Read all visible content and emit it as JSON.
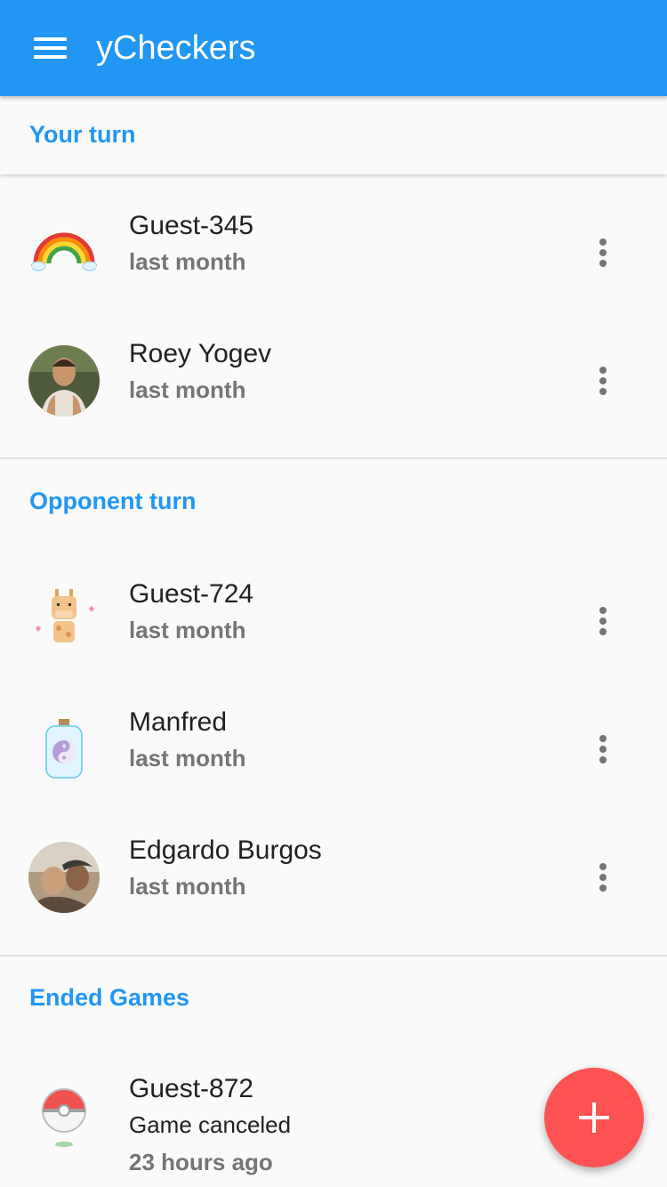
{
  "app": {
    "title": "yCheckers"
  },
  "sections": {
    "your_turn": "Your turn",
    "opponent_turn": "Opponent turn",
    "ended": "Ended Games"
  },
  "games": {
    "your_turn": [
      {
        "name": "Guest-345",
        "time": "last month",
        "avatar": "rainbow-avatar"
      },
      {
        "name": "Roey Yogev",
        "time": "last month",
        "avatar": "photo-avatar"
      }
    ],
    "opponent_turn": [
      {
        "name": "Guest-724",
        "time": "last month",
        "avatar": "giraffe-avatar"
      },
      {
        "name": "Manfred",
        "time": "last month",
        "avatar": "yin-yang-bottle-avatar"
      },
      {
        "name": "Edgardo Burgos",
        "time": "last month",
        "avatar": "photo-avatar"
      }
    ],
    "ended": [
      {
        "name": "Guest-872",
        "status": "Game canceled",
        "time": "23 hours ago",
        "avatar": "pokeball-avatar"
      }
    ]
  },
  "icons": {
    "menu": "menu-icon",
    "more": "more-vert-icon",
    "add": "add-icon"
  },
  "colors": {
    "primary": "#2196f3",
    "accent": "#ff5252",
    "background": "#fafafa"
  }
}
